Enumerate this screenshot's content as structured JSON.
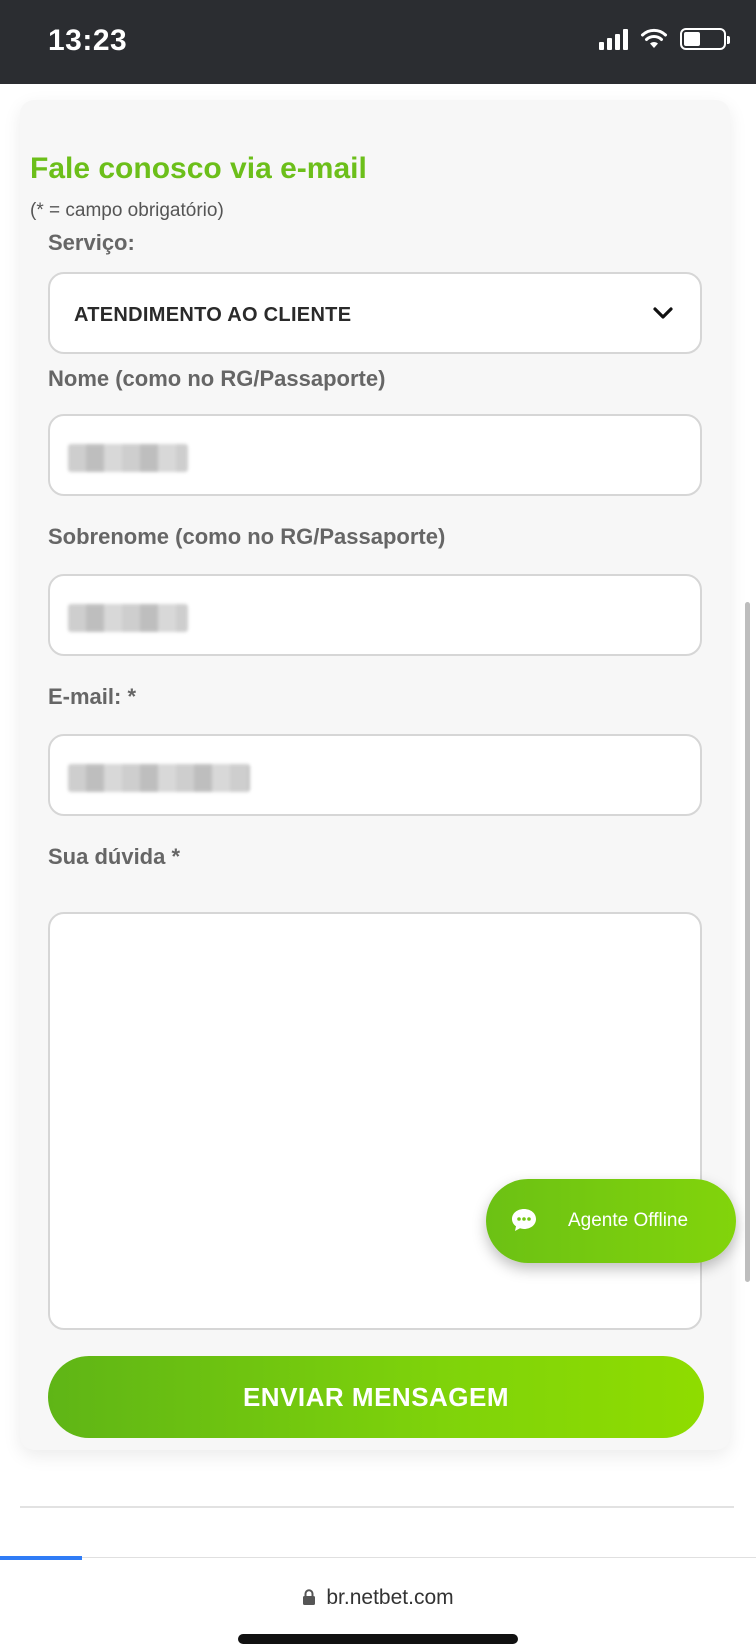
{
  "status_bar": {
    "time": "13:23",
    "battery_level": 0.4
  },
  "form": {
    "title": "Fale conosco via e-mail",
    "note": "(* = campo obrigatório)",
    "service": {
      "label": "Serviço:",
      "value": "ATENDIMENTO AO CLIENTE"
    },
    "first_name": {
      "label": "Nome (como no RG/Passaporte)"
    },
    "last_name": {
      "label": "Sobrenome (como no RG/Passaporte)"
    },
    "email": {
      "label": "E-mail: *"
    },
    "question": {
      "label": "Sua dúvida *",
      "value": ""
    },
    "submit_label": "ENVIAR MENSAGEM"
  },
  "chat_widget": {
    "label": "Agente Offline"
  },
  "browser": {
    "url": "br.netbet.com"
  },
  "colors": {
    "brand_green": "#6cbf1a",
    "button_green": "#7fd30a",
    "progress_blue": "#2f7cf6"
  }
}
